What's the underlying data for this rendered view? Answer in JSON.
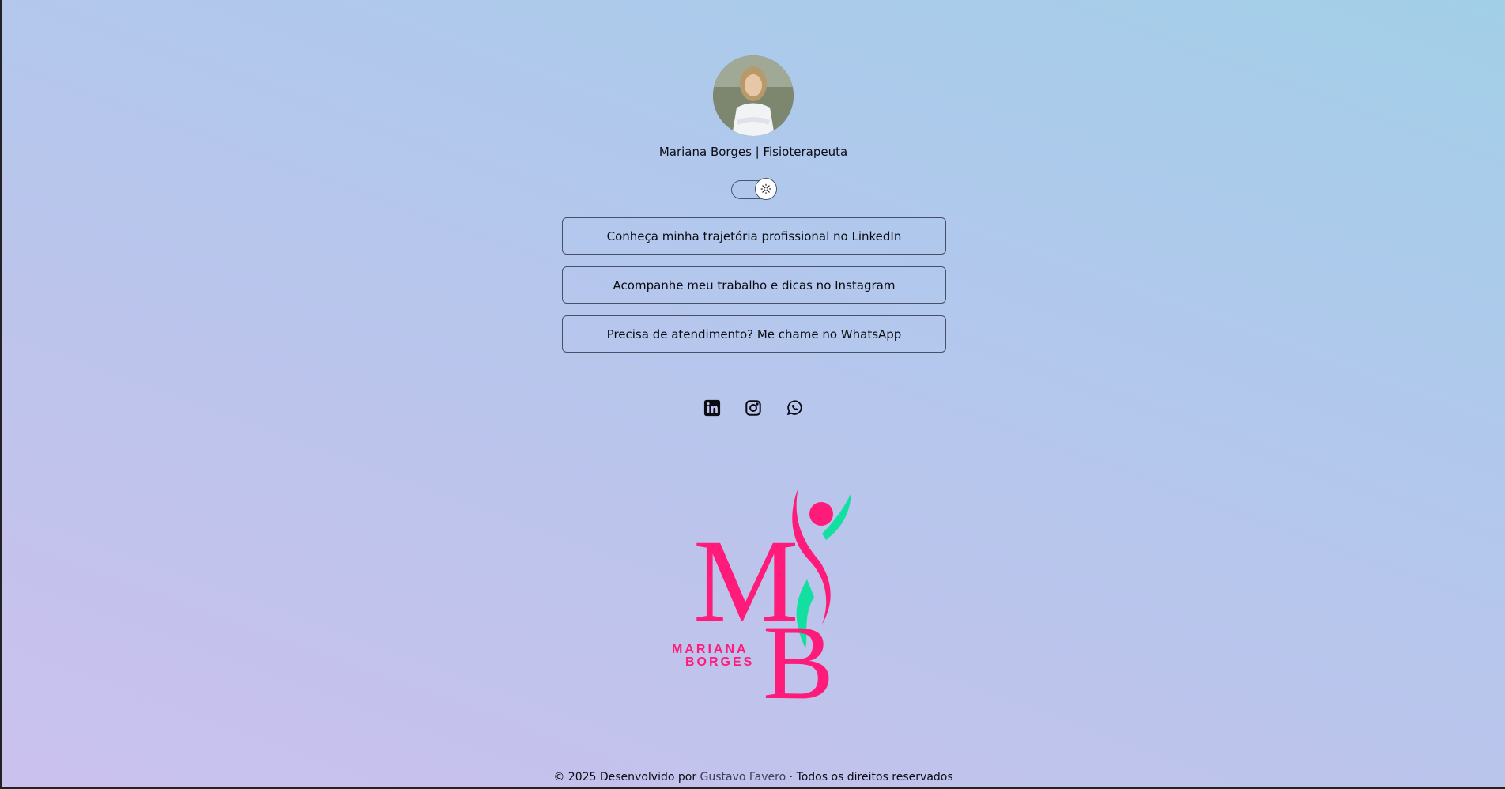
{
  "profile": {
    "name": "Mariana Borges | Fisioterapeuta"
  },
  "theme_toggle": {
    "icon": "sun-icon",
    "state": "light"
  },
  "links": [
    {
      "label": "Conheça minha trajetória profissional no LinkedIn"
    },
    {
      "label": "Acompanhe meu trabalho e dicas no Instagram"
    },
    {
      "label": "Precisa de atendimento? Me chame no WhatsApp"
    }
  ],
  "social_icons": [
    "linkedin-icon",
    "instagram-icon",
    "whatsapp-icon"
  ],
  "logo": {
    "line1": "MARIANA",
    "line2": "BORGES",
    "colors": {
      "primary": "#ff1b79",
      "accent": "#12e0a0"
    }
  },
  "footer": {
    "prefix": "© 2025 Desenvolvido por",
    "author": "Gustavo Favero",
    "suffix": "· Todos os direitos reservados"
  }
}
